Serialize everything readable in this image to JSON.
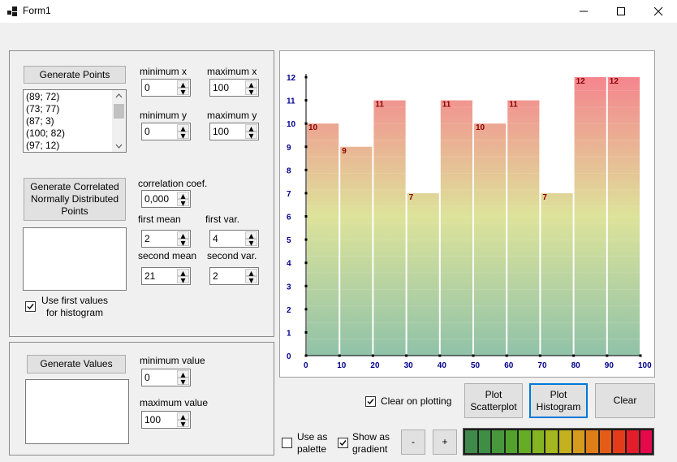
{
  "window": {
    "title": "Form1"
  },
  "points_group": {
    "generate_button": "Generate Points",
    "list": [
      "(89; 72)",
      "(73; 77)",
      "(87; 3)",
      "(100; 82)",
      "(97; 12)"
    ],
    "min_x_label": "minimum x",
    "min_x_value": "0",
    "max_x_label": "maximum x",
    "max_x_value": "100",
    "min_y_label": "minimum y",
    "min_y_value": "0",
    "max_y_label": "maximum y",
    "max_y_value": "100",
    "correlated_button": "Generate Correlated Normally Distributed Points",
    "correlation_label": "correlation coef.",
    "correlation_value": "0,000",
    "first_mean_label": "first mean",
    "first_mean_value": "2",
    "first_var_label": "first var.",
    "first_var_value": "4",
    "second_mean_label": "second mean",
    "second_mean_value": "21",
    "second_var_label": "second var.",
    "second_var_value": "2",
    "use_first_label": "Use first values for histogram",
    "use_first_checked": true
  },
  "values_group": {
    "generate_button": "Generate Values",
    "min_label": "minimum value",
    "min_value": "0",
    "max_label": "maximum value",
    "max_value": "100"
  },
  "controls": {
    "clear_on_plotting_label": "Clear on plotting",
    "clear_on_plotting_checked": true,
    "plot_scatter_button": "Plot Scatterplot",
    "plot_histogram_button": "Plot Histogram",
    "clear_button": "Clear",
    "use_as_palette_label": "Use as palette",
    "use_as_palette_checked": false,
    "show_gradient_label": "Show as gradient",
    "show_gradient_checked": true,
    "minus_button": "-",
    "plus_button": "+"
  },
  "palette": [
    "#3f8a4a",
    "#3f8e46",
    "#46983a",
    "#52a22e",
    "#66ad26",
    "#84b422",
    "#a4b71f",
    "#c3b21e",
    "#d69b1c",
    "#df7d19",
    "#e35d18",
    "#e43c1b",
    "#e31d2c",
    "#e3094a"
  ],
  "chart_data": {
    "type": "bar",
    "title": "",
    "xlabel": "",
    "ylabel": "",
    "bin_edges": [
      0,
      10,
      20,
      30,
      40,
      50,
      60,
      70,
      80,
      90,
      100
    ],
    "values": [
      10,
      9,
      11,
      7,
      11,
      10,
      11,
      7,
      12,
      12
    ],
    "value_labels": [
      "10",
      "9",
      "11",
      "7",
      "11",
      "10",
      "11",
      "7",
      "12",
      "12"
    ],
    "x_ticks": [
      "0",
      "10",
      "20",
      "30",
      "40",
      "50",
      "60",
      "70",
      "80",
      "90",
      "100"
    ],
    "y_ticks": [
      "0",
      "1",
      "2",
      "3",
      "4",
      "5",
      "6",
      "7",
      "8",
      "9",
      "10",
      "11",
      "12"
    ],
    "xlim": [
      0,
      100
    ],
    "ylim": [
      0,
      12
    ],
    "gradient": {
      "bottom": "#90c2a8",
      "middle": "#dde39a",
      "top": "#f5858e"
    },
    "grid": false
  }
}
